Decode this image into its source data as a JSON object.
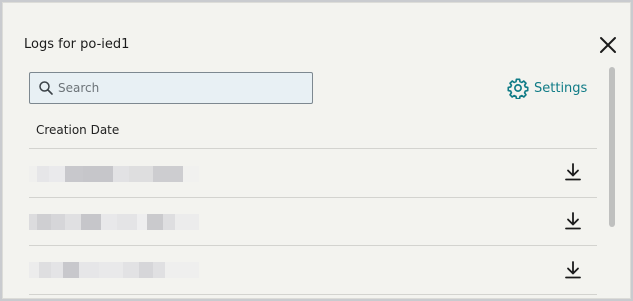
{
  "dialog": {
    "title": "Logs for po-ied1",
    "close_icon": "close-icon"
  },
  "search": {
    "placeholder": "Search",
    "value": "",
    "icon": "search-icon"
  },
  "settings": {
    "label": "Settings",
    "icon": "gear-icon",
    "color": "#0f7b86"
  },
  "table": {
    "columns": [
      "Creation Date"
    ],
    "rows": [
      {
        "creation_date": "",
        "download_icon": "download-icon"
      },
      {
        "creation_date": "",
        "download_icon": "download-icon"
      },
      {
        "creation_date": "",
        "download_icon": "download-icon"
      }
    ]
  }
}
